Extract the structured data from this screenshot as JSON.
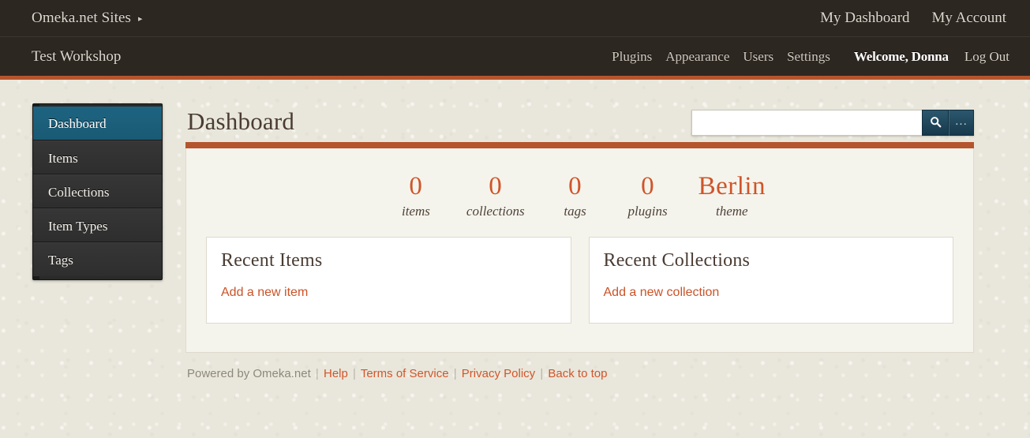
{
  "header": {
    "brand_label": "Omeka.net Sites",
    "brand_caret": "▸",
    "top_nav": [
      {
        "label": "My Dashboard"
      },
      {
        "label": "My Account"
      }
    ],
    "site_title": "Test Workshop",
    "admin_nav": [
      {
        "label": "Plugins"
      },
      {
        "label": "Appearance"
      },
      {
        "label": "Users"
      },
      {
        "label": "Settings"
      }
    ],
    "welcome_label": "Welcome, Donna",
    "logout_label": "Log Out"
  },
  "sidebar": {
    "items": [
      {
        "label": "Dashboard"
      },
      {
        "label": "Items"
      },
      {
        "label": "Collections"
      },
      {
        "label": "Item Types"
      },
      {
        "label": "Tags"
      }
    ]
  },
  "main": {
    "page_title": "Dashboard",
    "search": {
      "value": "",
      "placeholder": "",
      "search_icon": "search-icon",
      "options_label": "..."
    },
    "stats": [
      {
        "value": "0",
        "label": "items"
      },
      {
        "value": "0",
        "label": "collections"
      },
      {
        "value": "0",
        "label": "tags"
      },
      {
        "value": "0",
        "label": "plugins"
      },
      {
        "value": "Berlin",
        "label": "theme"
      }
    ],
    "cards": [
      {
        "title": "Recent Items",
        "link_label": "Add a new item"
      },
      {
        "title": "Recent Collections",
        "link_label": "Add a new collection"
      }
    ]
  },
  "footer": {
    "powered_by": "Powered by Omeka.net",
    "separator": "|",
    "links": [
      {
        "label": "Help"
      },
      {
        "label": "Terms of Service"
      },
      {
        "label": "Privacy Policy"
      },
      {
        "label": "Back to top"
      }
    ]
  },
  "colors": {
    "accent_orange": "#b4552e",
    "link_orange": "#cf5529",
    "header_brown": "#2d2721",
    "active_teal": "#1d6481",
    "page_bg": "#e9e7db"
  }
}
